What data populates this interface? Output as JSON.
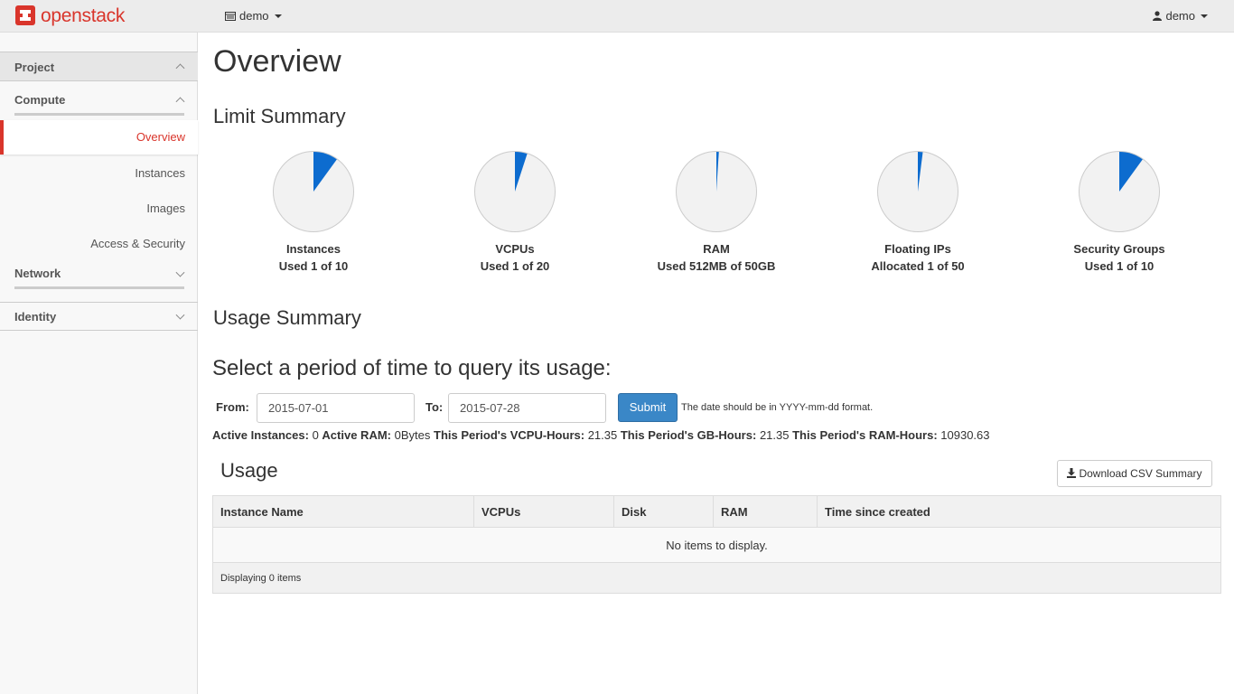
{
  "brand": {
    "name": "openstack",
    "color": "#d9352b"
  },
  "navbar": {
    "project_selector": "demo",
    "user_menu": "demo"
  },
  "sidebar": {
    "project": "Project",
    "compute": "Compute",
    "items": [
      {
        "label": "Overview",
        "active": true
      },
      {
        "label": "Instances"
      },
      {
        "label": "Images"
      },
      {
        "label": "Access & Security"
      }
    ],
    "network": "Network",
    "identity": "Identity"
  },
  "main": {
    "title": "Overview",
    "limit_summary": "Limit Summary",
    "limits": [
      {
        "name": "Instances",
        "usage": "Used 1 of 10",
        "fraction": 0.1
      },
      {
        "name": "VCPUs",
        "usage": "Used 1 of 20",
        "fraction": 0.05
      },
      {
        "name": "RAM",
        "usage": "Used 512MB of 50GB",
        "fraction": 0.01
      },
      {
        "name": "Floating IPs",
        "usage": "Allocated 1 of 50",
        "fraction": 0.02
      },
      {
        "name": "Security Groups",
        "usage": "Used 1 of 10",
        "fraction": 0.1
      }
    ],
    "pie_colors": {
      "used": "#0d6ccf",
      "free": "#f2f2f2",
      "border": "#ccc"
    },
    "usage_summary": "Usage Summary",
    "period_heading": "Select a period of time to query its usage:",
    "form": {
      "from_label": "From:",
      "from_value": "2015-07-01",
      "to_label": "To:",
      "to_value": "2015-07-28",
      "submit": "Submit",
      "help": "The date should be in YYYY-mm-dd format."
    },
    "stats": {
      "active_instances_label": "Active Instances:",
      "active_instances": "0",
      "active_ram_label": "Active RAM:",
      "active_ram": "0Bytes",
      "vcpu_hours_label": "This Period's VCPU-Hours:",
      "vcpu_hours": "21.35",
      "gb_hours_label": "This Period's GB-Hours:",
      "gb_hours": "21.35",
      "ram_hours_label": "This Period's RAM-Hours:",
      "ram_hours": "10930.63"
    },
    "usage_heading": "Usage",
    "csv_button": "Download CSV Summary",
    "table": {
      "columns": [
        "Instance Name",
        "VCPUs",
        "Disk",
        "RAM",
        "Time since created"
      ],
      "empty": "No items to display.",
      "footer": "Displaying 0 items"
    }
  }
}
